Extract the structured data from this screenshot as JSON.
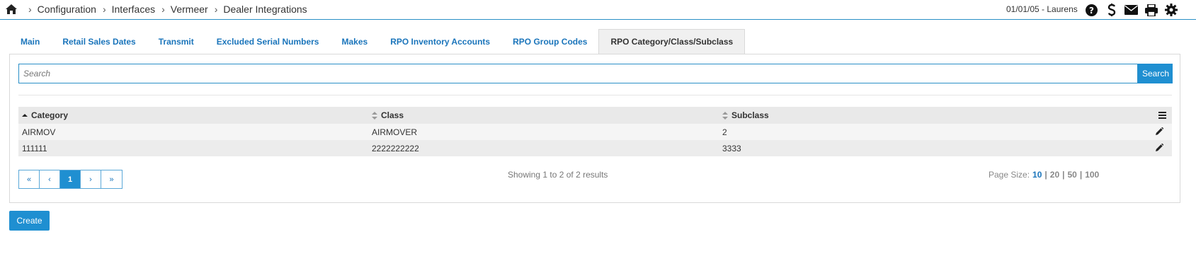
{
  "breadcrumb": {
    "items": [
      "Configuration",
      "Interfaces",
      "Vermeer",
      "Dealer Integrations"
    ],
    "separator": "›"
  },
  "header": {
    "user_info": "01/01/05 - Laurens",
    "icons": [
      "help-icon",
      "dollar-icon",
      "mail-icon",
      "print-icon",
      "gear-icon"
    ]
  },
  "tabs": [
    {
      "label": "Main",
      "active": false
    },
    {
      "label": "Retail Sales Dates",
      "active": false
    },
    {
      "label": "Transmit",
      "active": false
    },
    {
      "label": "Excluded Serial Numbers",
      "active": false
    },
    {
      "label": "Makes",
      "active": false
    },
    {
      "label": "RPO Inventory Accounts",
      "active": false
    },
    {
      "label": "RPO Group Codes",
      "active": false
    },
    {
      "label": "RPO Category/Class/Subclass",
      "active": true
    }
  ],
  "search": {
    "placeholder": "Search",
    "value": "",
    "button_label": "Search"
  },
  "table": {
    "columns": [
      "Category",
      "Class",
      "Subclass"
    ],
    "sorted_column": "Category",
    "rows": [
      [
        "AIRMOV",
        "AIRMOVER",
        "2"
      ],
      [
        "111111",
        "2222222222",
        "3333"
      ]
    ]
  },
  "pagination": {
    "first": "«",
    "prev": "‹",
    "current": "1",
    "next": "›",
    "last": "»",
    "summary": "Showing 1 to 2 of 2 results",
    "page_size_label": "Page Size:",
    "page_sizes": [
      "10",
      "20",
      "50",
      "100"
    ],
    "selected_page_size": "10"
  },
  "actions": {
    "create_label": "Create"
  },
  "colors": {
    "accent": "#1f8fd1",
    "link": "#1b75bb",
    "header_border": "#2a8fc7"
  }
}
